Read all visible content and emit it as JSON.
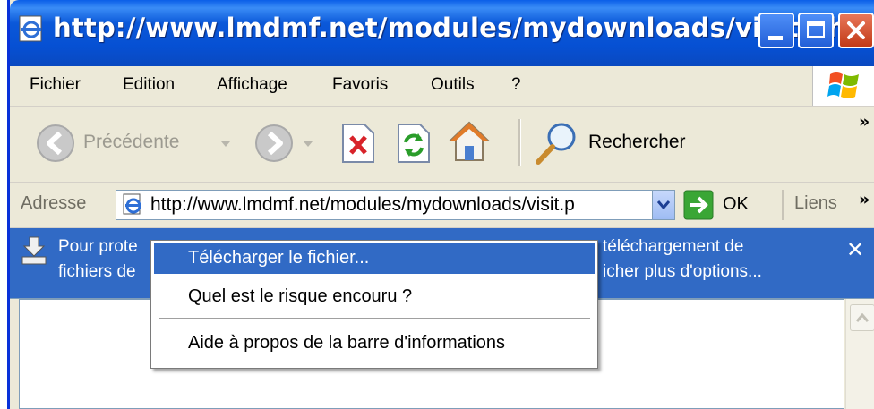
{
  "window": {
    "title": "http://www.lmdmf.net/modules/mydownloads/visit.ph...",
    "controls": [
      "minimize-button",
      "maximize-button",
      "close-button"
    ]
  },
  "menubar": {
    "items": [
      {
        "label": "Fichier"
      },
      {
        "label": "Edition"
      },
      {
        "label": "Affichage"
      },
      {
        "label": "Favoris"
      },
      {
        "label": "Outils"
      },
      {
        "label": "?"
      }
    ]
  },
  "toolbar": {
    "back_label": "Précédente",
    "search_label": "Rechercher",
    "overflow": "»"
  },
  "addressbar": {
    "label": "Adresse",
    "url": "http://www.lmdmf.net/modules/mydownloads/visit.p",
    "go_label": "OK",
    "links_label": "Liens",
    "overflow": "»"
  },
  "infobar": {
    "line1_left": "Pour prote",
    "line1_right": "téléchargement de",
    "line2_left": "fichiers de",
    "line2_right": "icher plus d'options...",
    "close_glyph": "✕"
  },
  "context_menu": {
    "items": [
      {
        "label": "Télécharger le fichier..."
      },
      {
        "label": "Quel est le risque encouru ?"
      },
      {
        "label": "Aide à propos de la barre d'informations"
      }
    ]
  },
  "colors": {
    "titlebar": "#0a58d9",
    "infobar": "#316ac5",
    "menu_highlight": "#316ac5"
  }
}
